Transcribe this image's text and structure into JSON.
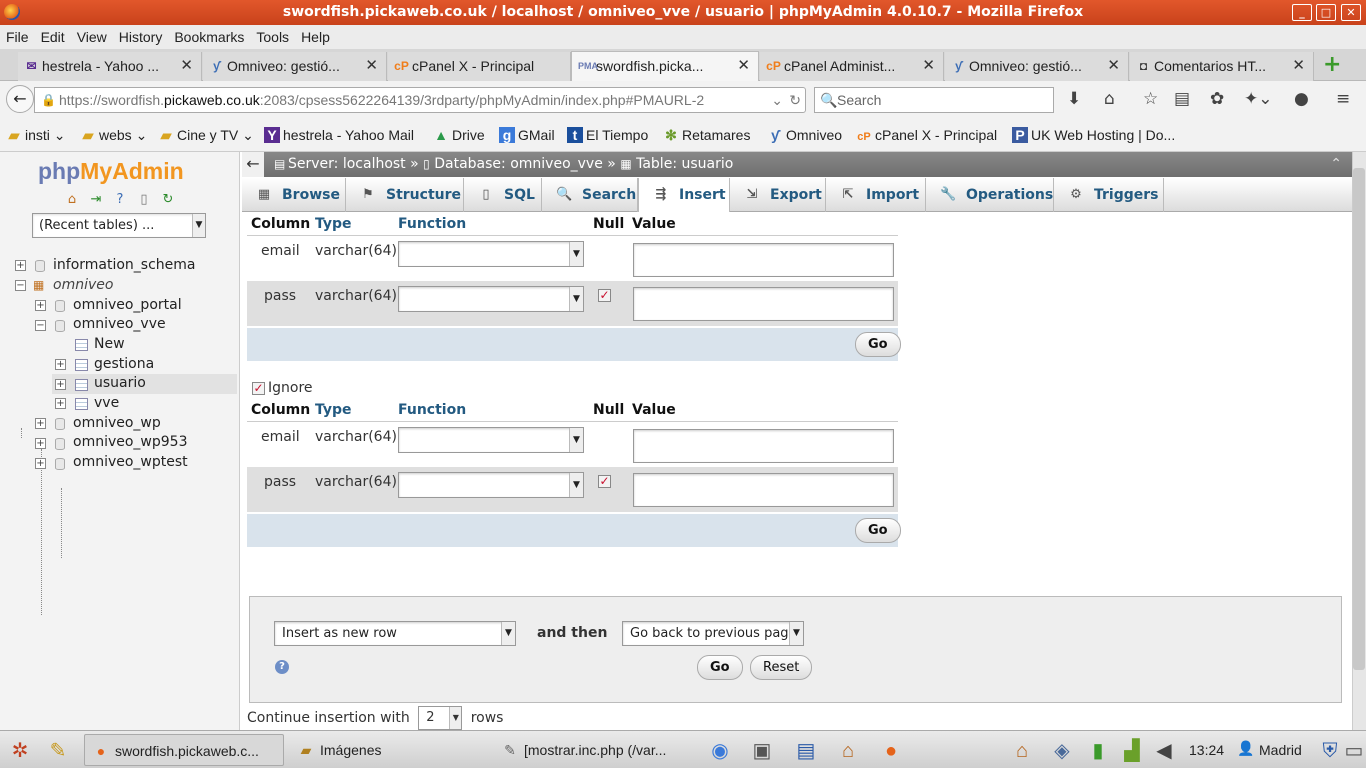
{
  "window": {
    "title": "swordfish.pickaweb.co.uk / localhost / omniveo_vve / usuario | phpMyAdmin 4.0.10.7 - Mozilla Firefox"
  },
  "menu": [
    "File",
    "Edit",
    "View",
    "History",
    "Bookmarks",
    "Tools",
    "Help"
  ],
  "tabs": [
    {
      "label": "hestrela - Yahoo ...",
      "icon": "yahoo-mail-icon"
    },
    {
      "label": "Omniveo: gestió...",
      "icon": "omniveo-icon"
    },
    {
      "label": "cPanel X - Principal",
      "icon": "cpanel-icon"
    },
    {
      "label": "swordfish.picka...",
      "icon": "phpmyadmin-icon"
    },
    {
      "label": "cPanel Administ...",
      "icon": "cpanel-icon"
    },
    {
      "label": "Omniveo: gestió...",
      "icon": "omniveo-icon"
    },
    {
      "label": "Comentarios HT...",
      "icon": "page-icon"
    }
  ],
  "url": {
    "prefix": "https://swordfish.",
    "host": "pickaweb.co.uk",
    "rest": ":2083/cpsess5622264139/3rdparty/phpMyAdmin/index.php#PMAURL-2"
  },
  "search": {
    "placeholder": "Search"
  },
  "bookmarks": [
    "insti",
    "webs",
    "Cine y TV",
    "hestrela - Yahoo Mail",
    "Drive",
    "GMail",
    "El Tiempo",
    "Retamares",
    "Omniveo",
    "cPanel X - Principal",
    "UK Web Hosting | Do..."
  ],
  "sidebar": {
    "logo_php": "php",
    "logo_my": "MyAdmin",
    "recent": "(Recent tables) ...",
    "tree": [
      "information_schema",
      "omniveo",
      "omniveo_portal",
      "omniveo_vve",
      "New",
      "gestiona",
      "usuario",
      "vve",
      "omniveo_wp",
      "omniveo_wp953",
      "omniveo_wptest"
    ]
  },
  "breadcrumb": {
    "server": "Server: localhost",
    "database": "Database: omniveo_vve",
    "table": "Table: usuario",
    "sep": "»"
  },
  "pma_tabs": [
    "Browse",
    "Structure",
    "SQL",
    "Search",
    "Insert",
    "Export",
    "Import",
    "Operations",
    "Triggers"
  ],
  "form": {
    "headers": {
      "column": "Column",
      "type": "Type",
      "function": "Function",
      "null": "Null",
      "value": "Value"
    },
    "rows": [
      {
        "column": "email",
        "type": "varchar(64)"
      },
      {
        "column": "pass",
        "type": "varchar(64)"
      }
    ],
    "go": "Go",
    "ignore": "Ignore"
  },
  "bottom": {
    "insert_mode": "Insert as new row",
    "and_then": "and then",
    "after": "Go back to previous page",
    "go": "Go",
    "reset": "Reset",
    "continue_label": "Continue insertion with",
    "continue_rows": "2",
    "rows_label": "rows"
  },
  "taskbar": {
    "tasks": [
      "swordfish.pickaweb.c...",
      "Imágenes",
      "[mostrar.inc.php (/var..."
    ],
    "clock": "13:24",
    "user": "Madrid"
  }
}
